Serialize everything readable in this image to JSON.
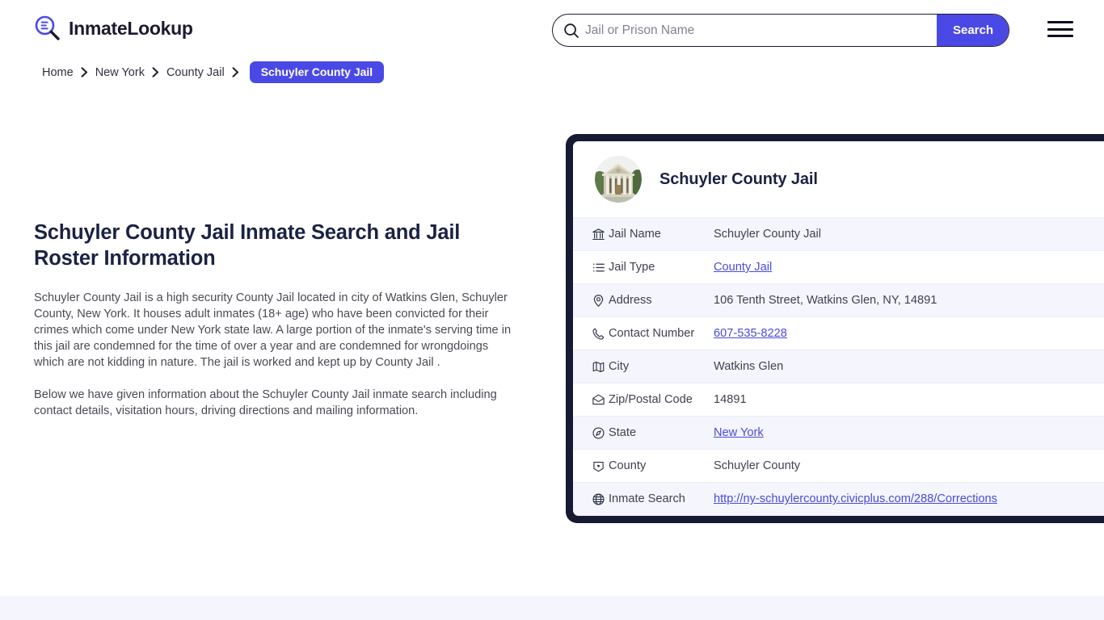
{
  "brand": {
    "name": "InmateLookup",
    "logo_icon": "magnifier-person-icon",
    "accent_color": "#4b49e6",
    "dark_color": "#161b33"
  },
  "search": {
    "placeholder": "Jail or Prison Name",
    "value": "",
    "button_label": "Search",
    "icon": "search-icon"
  },
  "menu": {
    "icon": "hamburger-menu-icon"
  },
  "breadcrumb": {
    "items": [
      {
        "label": "Home"
      },
      {
        "label": "New York"
      },
      {
        "label": "County Jail"
      }
    ],
    "current": "Schuyler County Jail",
    "separator_icon": "chevron-right-icon"
  },
  "main": {
    "title": "Schuyler County Jail Inmate Search and Jail Roster Information",
    "paragraphs": [
      "Schuyler County Jail is a high security County Jail located in city of Watkins Glen, Schuyler County, New York. It houses adult inmates (18+ age) who have been convicted for their crimes which come under New York state law. A large portion of the inmate's serving time in this jail are condemned for the time of over a year and are condemned for wrongdoings which are not kidding in nature. The jail is worked and kept up by County Jail .",
      "Below we have given information about the Schuyler County Jail inmate search including contact details, visitation hours, driving directions and mailing information."
    ]
  },
  "card": {
    "photo_alt": "Schuyler County Jail courthouse building",
    "title": "Schuyler County Jail",
    "rows": [
      {
        "icon": "bank-icon",
        "label": "Jail Name",
        "value": "Schuyler County Jail",
        "is_link": false
      },
      {
        "icon": "list-icon",
        "label": "Jail Type",
        "value": "County Jail",
        "is_link": true
      },
      {
        "icon": "map-pin-icon",
        "label": "Address",
        "value": "106 Tenth Street, Watkins Glen, NY, 14891",
        "is_link": false
      },
      {
        "icon": "phone-icon",
        "label": "Contact Number",
        "value": "607-535-8228",
        "is_link": true
      },
      {
        "icon": "map-icon",
        "label": "City",
        "value": "Watkins Glen",
        "is_link": false
      },
      {
        "icon": "envelope-icon",
        "label": "Zip/Postal Code",
        "value": "14891",
        "is_link": false
      },
      {
        "icon": "globe-compass-icon",
        "label": "State",
        "value": "New York",
        "is_link": true
      },
      {
        "icon": "county-badge-icon",
        "label": "County",
        "value": "Schuyler County",
        "is_link": false
      },
      {
        "icon": "globe-icon",
        "label": "Inmate Search",
        "value": "http://ny-schuylercounty.civicplus.com/288/Corrections",
        "is_link": true
      }
    ]
  }
}
